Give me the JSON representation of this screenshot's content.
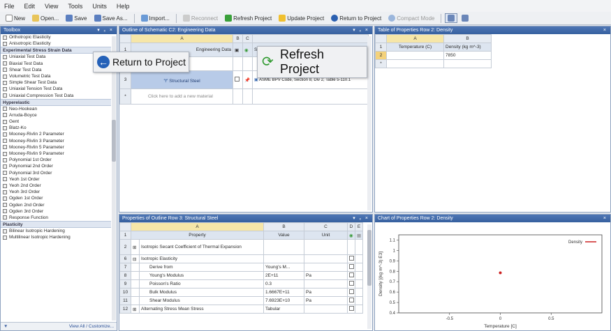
{
  "menu": [
    "File",
    "Edit",
    "View",
    "Tools",
    "Units",
    "Help"
  ],
  "toolbar": {
    "new": "New",
    "open": "Open...",
    "save": "Save",
    "save_as": "Save As...",
    "import": "Import...",
    "reconnect": "Reconnect",
    "refresh": "Refresh Project",
    "update": "Update Project",
    "return": "Return to Project",
    "compact": "Compact Mode"
  },
  "colors": {
    "title": "#3d67a8",
    "selected": "#f4d27c",
    "colA": "#f6e6a8",
    "series": "#cc2222"
  },
  "toolbox": {
    "title": "Toolbox",
    "sections": [
      {
        "type": "items",
        "items": [
          "Orthotropic Elasticity",
          "Anisotropic Elasticity"
        ]
      },
      {
        "type": "cat",
        "label": "Experimental Stress Strain Data"
      },
      {
        "type": "items",
        "items": [
          "Uniaxial Test Data",
          "Biaxial Test Data",
          "Shear Test Data",
          "Volumetric Test Data",
          "Simple Shear Test Data",
          "Uniaxial Tension Test Data",
          "Uniaxial Compression Test Data"
        ]
      },
      {
        "type": "cat",
        "label": "Hyperelastic"
      },
      {
        "type": "items",
        "items": [
          "Neo-Hookean",
          "Arruda-Boyce",
          "Gent",
          "Blatz-Ko",
          "Mooney-Rivlin 2 Parameter",
          "Mooney-Rivlin 3 Parameter",
          "Mooney-Rivlin 5 Parameter",
          "Mooney-Rivlin 9 Parameter",
          "Polynomial 1st Order",
          "Polynomial 2nd Order",
          "Polynomial 3rd Order",
          "Yeoh 1st Order",
          "Yeoh 2nd Order",
          "Yeoh 3rd Order",
          "Ogden 1st Order",
          "Ogden 2nd Order",
          "Ogden 3rd Order",
          "Response Function"
        ]
      },
      {
        "type": "cat",
        "label": "Plasticity"
      },
      {
        "type": "items",
        "items": [
          "Bilinear Isotropic Hardening",
          "Multilinear Isotropic Hardening"
        ]
      }
    ],
    "footer": "View All / Customize..."
  },
  "outline": {
    "title": "Outline of Schematic C2: Engineering Data",
    "cols": [
      "A",
      "B",
      "C"
    ],
    "header_row": {
      "num": "1",
      "label": "Engineering Data",
      "source": "Source"
    },
    "row3": {
      "num": "3",
      "label": "Structural Steel",
      "desc": "ASME BPV Code, Section 8, Div 2, Table 5-110.1"
    },
    "row_new": {
      "num": "*",
      "label": "Click here to add a new material"
    }
  },
  "overlay": {
    "return_label": "Return to Project",
    "refresh_label": "Refresh Project"
  },
  "table_props": {
    "title": "Table of Properties Row 2: Density",
    "cols": [
      "A",
      "B"
    ],
    "header": {
      "num": "1",
      "a": "Temperature (C)",
      "b": "Density (kg m^-3)"
    },
    "row2": {
      "num": "2",
      "a": "",
      "b": "7850"
    },
    "row_new": {
      "num": "*"
    }
  },
  "properties": {
    "title": "Properties of Outline Row 3: Structural Steel",
    "cols": [
      "A",
      "B",
      "C",
      "D",
      "E"
    ],
    "header": {
      "num": "1",
      "property": "Property",
      "value": "Value",
      "unit": "Unit"
    },
    "rows": [
      {
        "num": "2",
        "exp": "⊞",
        "property": "Isotropic Secant Coefficient of Thermal Expansion",
        "value": "",
        "unit": ""
      },
      {
        "num": "6",
        "exp": "⊟",
        "property": "Isotropic Elasticity",
        "value": "",
        "unit": ""
      },
      {
        "num": "7",
        "exp": "",
        "property": "Derive from",
        "value": "Young's M...",
        "unit": ""
      },
      {
        "num": "8",
        "exp": "",
        "property": "Young's Modulus",
        "value": "2E+11",
        "unit": "Pa"
      },
      {
        "num": "9",
        "exp": "",
        "property": "Poisson's Ratio",
        "value": "0.3",
        "unit": ""
      },
      {
        "num": "10",
        "exp": "",
        "property": "Bulk Modulus",
        "value": "1.6667E+11",
        "unit": "Pa"
      },
      {
        "num": "11",
        "exp": "",
        "property": "Shear Modulus",
        "value": "7.6923E+10",
        "unit": "Pa"
      },
      {
        "num": "12",
        "exp": "⊞",
        "property": "Alternating Stress Mean Stress",
        "value": "Tabular",
        "unit": ""
      }
    ]
  },
  "chart_panel": {
    "title": "Chart of Properties Row 2: Density",
    "legend": "Density",
    "ylabel": "Density [(kg m^-3) E3]",
    "xlabel": "Temperature [C]",
    "yticks": [
      "1.1",
      "1",
      "0.9",
      "0.8",
      "0.7",
      "0.6",
      "0.5",
      "0.4"
    ],
    "xticks": [
      "-0.5",
      "0",
      "0.5"
    ]
  },
  "chart_data": {
    "type": "scatter",
    "series": [
      {
        "name": "Density",
        "x": [
          0
        ],
        "y": [
          0.785
        ]
      }
    ],
    "xlabel": "Temperature [C]",
    "ylabel": "Density [(kg m^-3) E3]",
    "xlim": [
      -1,
      1
    ],
    "ylim": [
      0.4,
      1.15
    ],
    "grid": false,
    "legend": "top-right"
  }
}
